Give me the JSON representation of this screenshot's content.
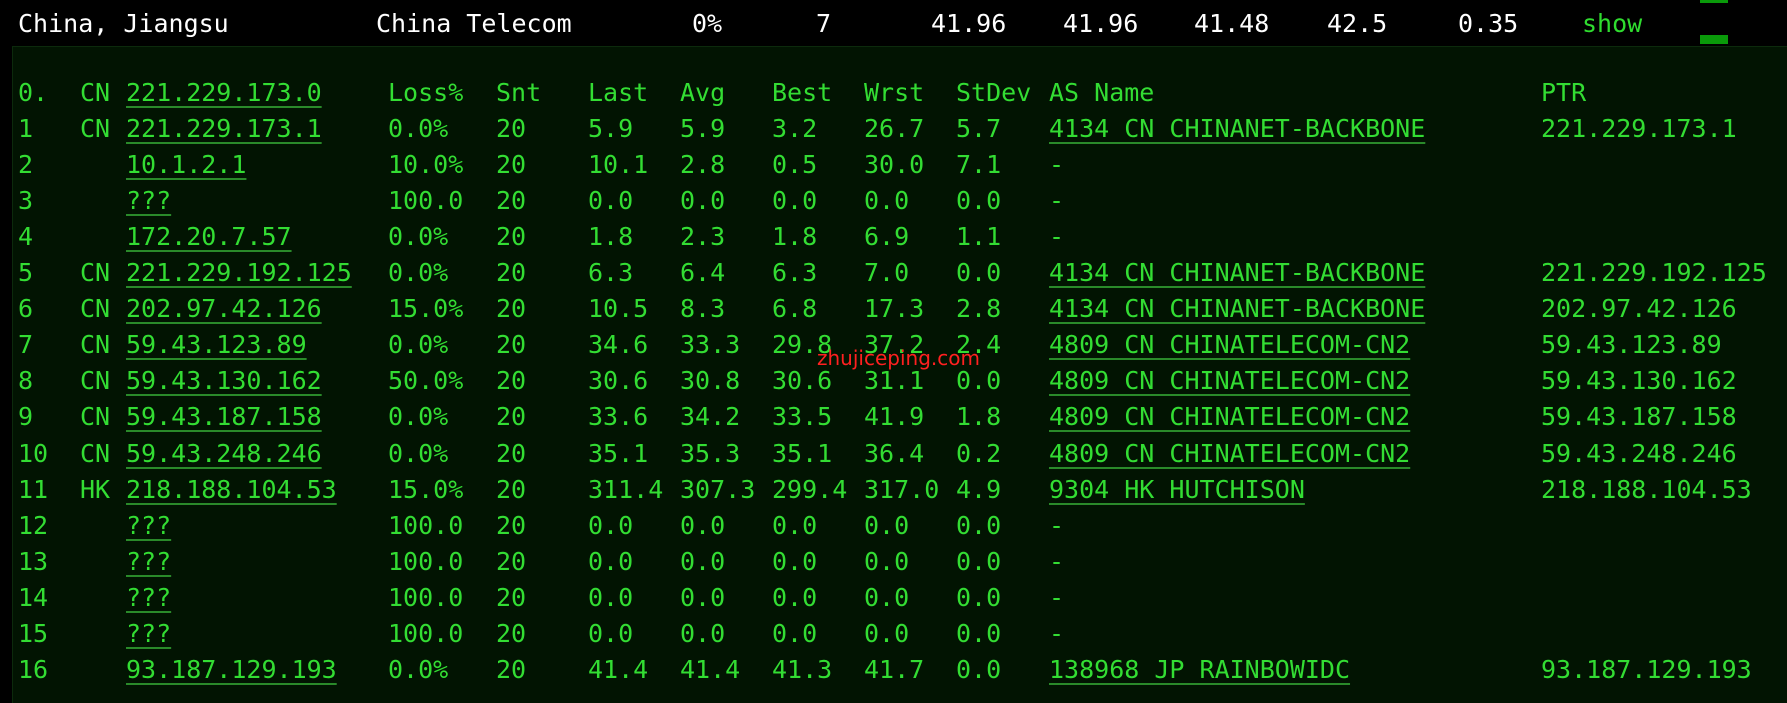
{
  "colors": {
    "background": "#000000",
    "panel": "#021402",
    "text_green": "#33dd33",
    "header_white": "#ffffff",
    "watermark_red": "#ff2020",
    "scrollbar_green": "#0a9a0a"
  },
  "summary": {
    "location": "China, Jiangsu",
    "isp": "China Telecom",
    "loss": "0%",
    "count": "7",
    "last": "41.96",
    "avg": "41.96",
    "best": "41.48",
    "worst": "42.5",
    "stdev": "0.35",
    "show_label": "show"
  },
  "table": {
    "columns": [
      "Loss%",
      "Snt",
      "Last",
      "Avg",
      "Best",
      "Wrst",
      "StDev",
      "AS Name",
      "PTR"
    ],
    "target": {
      "idx": "0.",
      "cc": "CN",
      "host": "221.229.173.0"
    },
    "rows": [
      {
        "hop": "1",
        "cc": "CN",
        "host": "221.229.173.1",
        "loss": "0.0%",
        "snt": "20",
        "last": "5.9",
        "avg": "5.9",
        "best": "3.2",
        "wrst": "26.7",
        "stdev": "5.7",
        "as_name": "4134  CN CHINANET-BACKBONE",
        "ptr": "221.229.173.1"
      },
      {
        "hop": "2",
        "cc": "",
        "host": "10.1.2.1",
        "loss": "10.0%",
        "snt": "20",
        "last": "10.1",
        "avg": "2.8",
        "best": "0.5",
        "wrst": "30.0",
        "stdev": "7.1",
        "as_name": "-",
        "ptr": ""
      },
      {
        "hop": "3",
        "cc": "",
        "host": "???",
        "loss": "100.0",
        "snt": "20",
        "last": "0.0",
        "avg": "0.0",
        "best": "0.0",
        "wrst": "0.0",
        "stdev": "0.0",
        "as_name": "-",
        "ptr": ""
      },
      {
        "hop": "4",
        "cc": "",
        "host": "172.20.7.57",
        "loss": "0.0%",
        "snt": "20",
        "last": "1.8",
        "avg": "2.3",
        "best": "1.8",
        "wrst": "6.9",
        "stdev": "1.1",
        "as_name": "-",
        "ptr": ""
      },
      {
        "hop": "5",
        "cc": "CN",
        "host": "221.229.192.125",
        "loss": "0.0%",
        "snt": "20",
        "last": "6.3",
        "avg": "6.4",
        "best": "6.3",
        "wrst": "7.0",
        "stdev": "0.0",
        "as_name": "4134  CN CHINANET-BACKBONE",
        "ptr": "221.229.192.125"
      },
      {
        "hop": "6",
        "cc": "CN",
        "host": "202.97.42.126",
        "loss": "15.0%",
        "snt": "20",
        "last": "10.5",
        "avg": "8.3",
        "best": "6.8",
        "wrst": "17.3",
        "stdev": "2.8",
        "as_name": "4134  CN CHINANET-BACKBONE",
        "ptr": "202.97.42.126"
      },
      {
        "hop": "7",
        "cc": "CN",
        "host": "59.43.123.89",
        "loss": "0.0%",
        "snt": "20",
        "last": "34.6",
        "avg": "33.3",
        "best": "29.8",
        "wrst": "37.2",
        "stdev": "2.4",
        "as_name": "4809  CN CHINATELECOM-CN2",
        "ptr": "59.43.123.89"
      },
      {
        "hop": "8",
        "cc": "CN",
        "host": "59.43.130.162",
        "loss": "50.0%",
        "snt": "20",
        "last": "30.6",
        "avg": "30.8",
        "best": "30.6",
        "wrst": "31.1",
        "stdev": "0.0",
        "as_name": "4809  CN CHINATELECOM-CN2",
        "ptr": "59.43.130.162"
      },
      {
        "hop": "9",
        "cc": "CN",
        "host": "59.43.187.158",
        "loss": "0.0%",
        "snt": "20",
        "last": "33.6",
        "avg": "34.2",
        "best": "33.5",
        "wrst": "41.9",
        "stdev": "1.8",
        "as_name": "4809  CN CHINATELECOM-CN2",
        "ptr": "59.43.187.158"
      },
      {
        "hop": "10",
        "cc": "CN",
        "host": "59.43.248.246",
        "loss": "0.0%",
        "snt": "20",
        "last": "35.1",
        "avg": "35.3",
        "best": "35.1",
        "wrst": "36.4",
        "stdev": "0.2",
        "as_name": "4809  CN CHINATELECOM-CN2",
        "ptr": "59.43.248.246"
      },
      {
        "hop": "11",
        "cc": "HK",
        "host": "218.188.104.53",
        "loss": "15.0%",
        "snt": "20",
        "last": "311.4",
        "avg": "307.3",
        "best": "299.4",
        "wrst": "317.0",
        "stdev": "4.9",
        "as_name": "9304  HK HUTCHISON",
        "ptr": "218.188.104.53"
      },
      {
        "hop": "12",
        "cc": "",
        "host": "???",
        "loss": "100.0",
        "snt": "20",
        "last": "0.0",
        "avg": "0.0",
        "best": "0.0",
        "wrst": "0.0",
        "stdev": "0.0",
        "as_name": "-",
        "ptr": ""
      },
      {
        "hop": "13",
        "cc": "",
        "host": "???",
        "loss": "100.0",
        "snt": "20",
        "last": "0.0",
        "avg": "0.0",
        "best": "0.0",
        "wrst": "0.0",
        "stdev": "0.0",
        "as_name": "-",
        "ptr": ""
      },
      {
        "hop": "14",
        "cc": "",
        "host": "???",
        "loss": "100.0",
        "snt": "20",
        "last": "0.0",
        "avg": "0.0",
        "best": "0.0",
        "wrst": "0.0",
        "stdev": "0.0",
        "as_name": "-",
        "ptr": ""
      },
      {
        "hop": "15",
        "cc": "",
        "host": "???",
        "loss": "100.0",
        "snt": "20",
        "last": "0.0",
        "avg": "0.0",
        "best": "0.0",
        "wrst": "0.0",
        "stdev": "0.0",
        "as_name": "-",
        "ptr": ""
      },
      {
        "hop": "16",
        "cc": "",
        "host": "93.187.129.193",
        "loss": "0.0%",
        "snt": "20",
        "last": "41.4",
        "avg": "41.4",
        "best": "41.3",
        "wrst": "41.7",
        "stdev": "0.0",
        "as_name": "138968 JP RAINBOWIDC",
        "ptr": "93.187.129.193"
      }
    ]
  },
  "watermark": "zhujiceping.com"
}
